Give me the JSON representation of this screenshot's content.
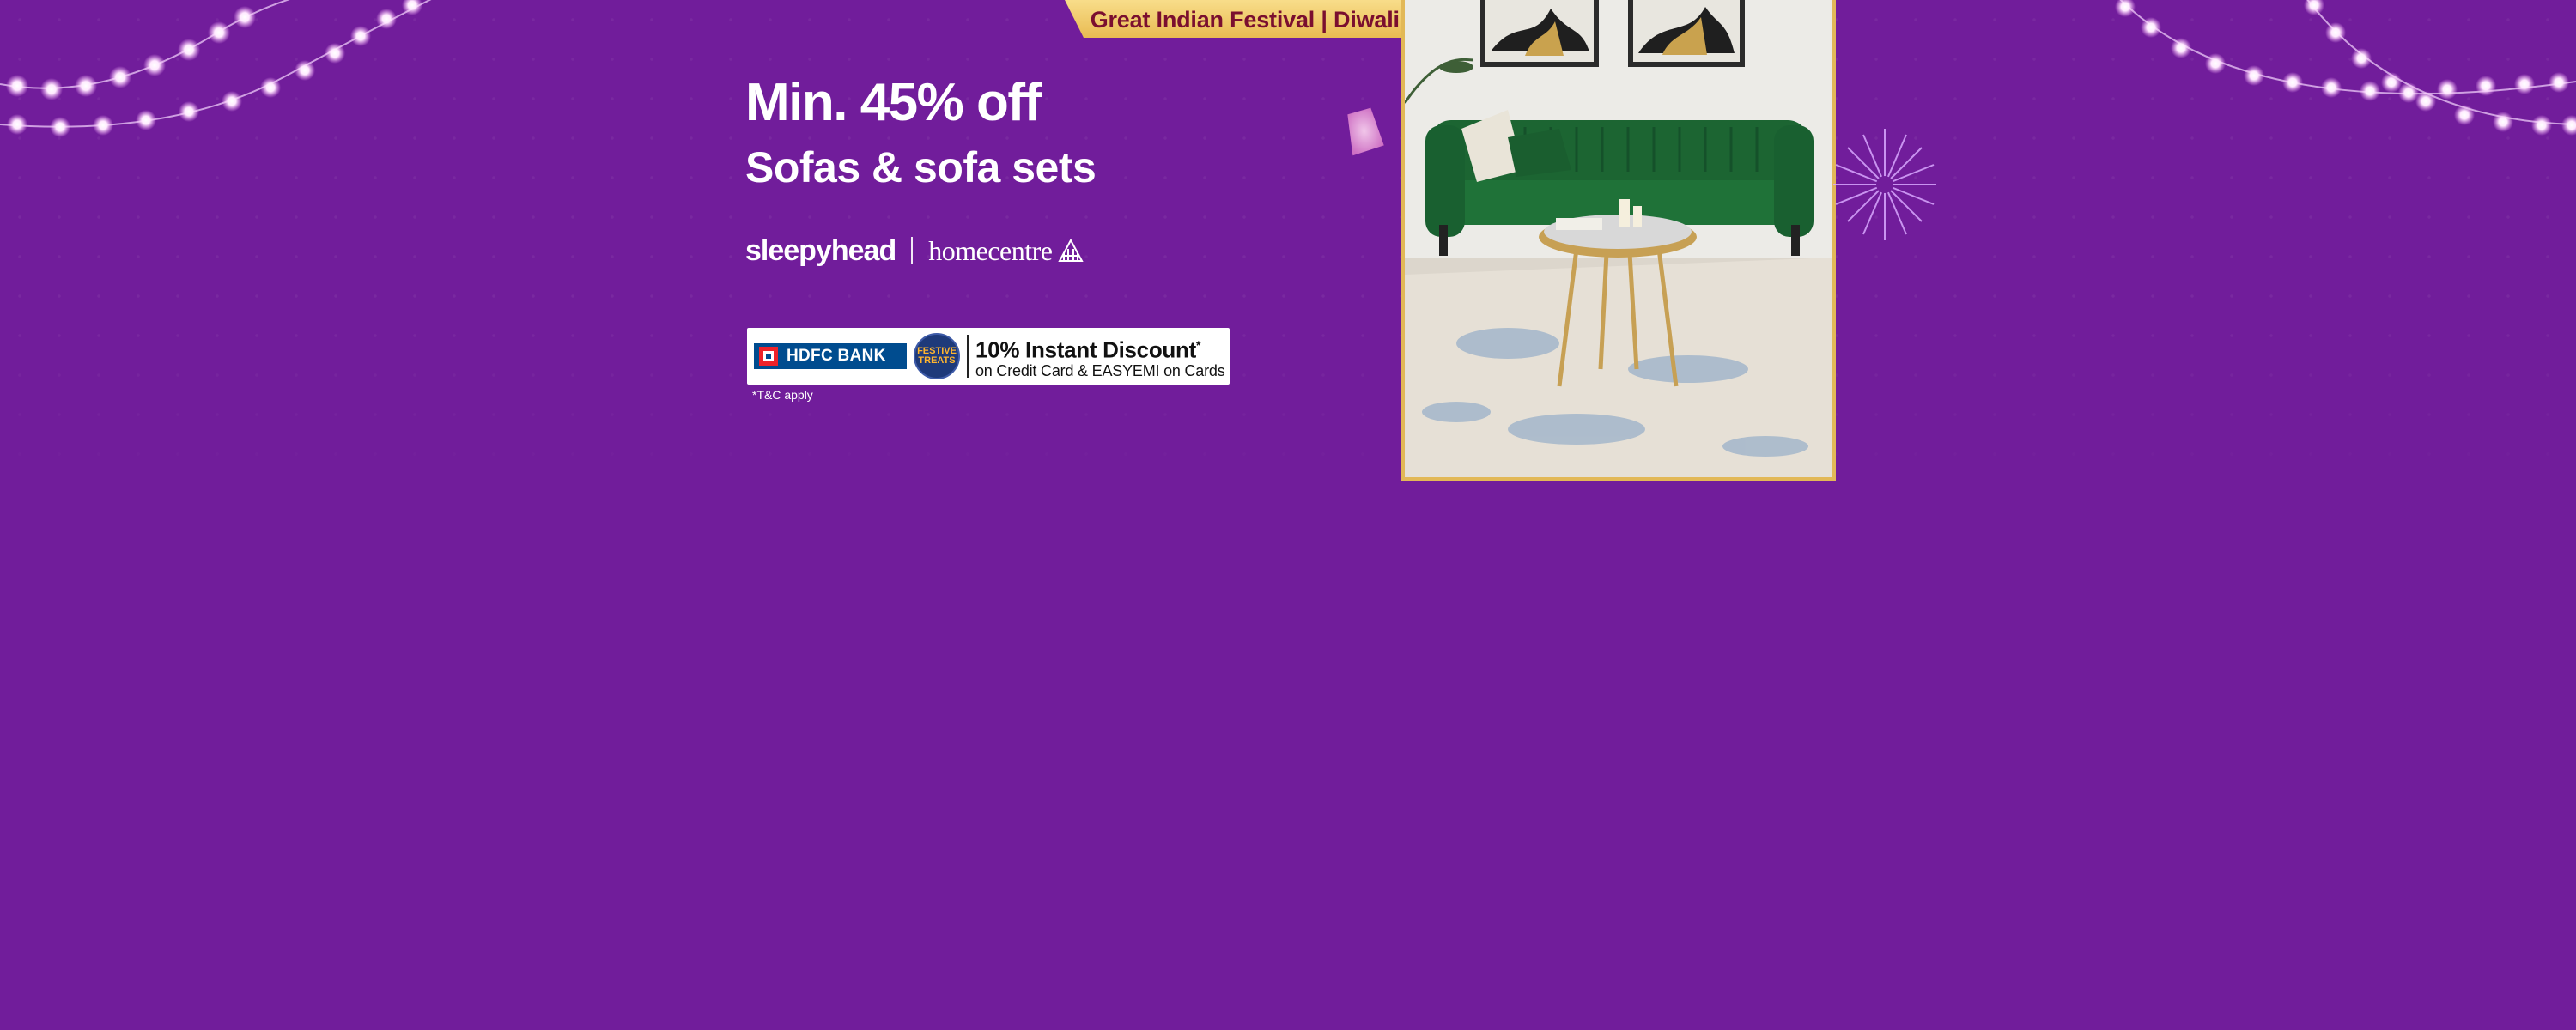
{
  "banner": {
    "festival_label": "Great Indian Festival | Diwali Special"
  },
  "offer": {
    "title": "Min. 45% off",
    "subtitle": "Sofas & sofa sets"
  },
  "brands": {
    "primary": "sleepyhead",
    "secondary": "homecentre",
    "secondary_icon": "homecentre-logo-icon"
  },
  "bank_offer": {
    "bank_name": "HDFC BANK",
    "badge_line1": "FESTIVE",
    "badge_line2": "TREATS",
    "discount_text": "10% Instant Discount",
    "discount_mark": "*",
    "terms_text": "on Credit Card & EASYEMI on Cards",
    "tc_note": "*T&C apply"
  },
  "product_image": {
    "icon": "green-sofa-with-coffee-table-image"
  },
  "decorations": {
    "left": "string-lights-icon",
    "right": "string-lights-icon",
    "lantern": "sky-lantern-icon",
    "firework": "firework-icon"
  },
  "colors": {
    "background": "#711d9b",
    "banner_gold": "#f2cf74",
    "banner_text": "#7a0f2f",
    "frame_gold": "#e2b857",
    "hdfc_blue": "#004c8f",
    "hdfc_red": "#ed232a",
    "sofa_green": "#1f6b33"
  }
}
